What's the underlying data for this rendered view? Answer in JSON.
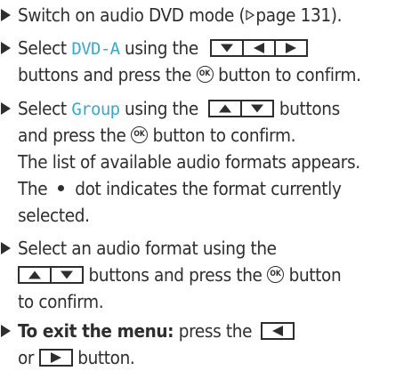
{
  "steps": [
    {
      "line1": {
        "a": "Switch on audio DVD mode (",
        "page": "page 131",
        "b": ")."
      }
    },
    {
      "line1": {
        "a": "Select ",
        "kw": "DVD-A",
        "b": " using the",
        "c": ""
      },
      "line2": {
        "a": "buttons and press the",
        "b": "button to confirm."
      }
    },
    {
      "line1": {
        "a": "Select ",
        "kw": "Group",
        "b": " using the",
        "c": "buttons"
      },
      "line2": {
        "a": "and press the",
        "b": "button to confirm."
      },
      "line3": "The list of available audio formats appears.",
      "line4": {
        "a": "The",
        "b": "dot indicates the format currently"
      },
      "line5": "selected."
    },
    {
      "line1": "Select an audio format using the",
      "line2": {
        "a": "buttons and press the",
        "b": "button"
      },
      "line3": "to confirm."
    },
    {
      "line1": {
        "bold": "To exit the menu:",
        "a": " press the"
      },
      "line2": {
        "a": "or",
        "b": "button."
      }
    }
  ],
  "ok_label": "OK",
  "icons": [
    "bullet-triangle",
    "page-ref-triangle",
    "arrow-down",
    "arrow-up",
    "arrow-left",
    "arrow-right",
    "ok-button"
  ],
  "colors": {
    "text": "#2e2e2e",
    "highlight": "#3aa9c9"
  }
}
